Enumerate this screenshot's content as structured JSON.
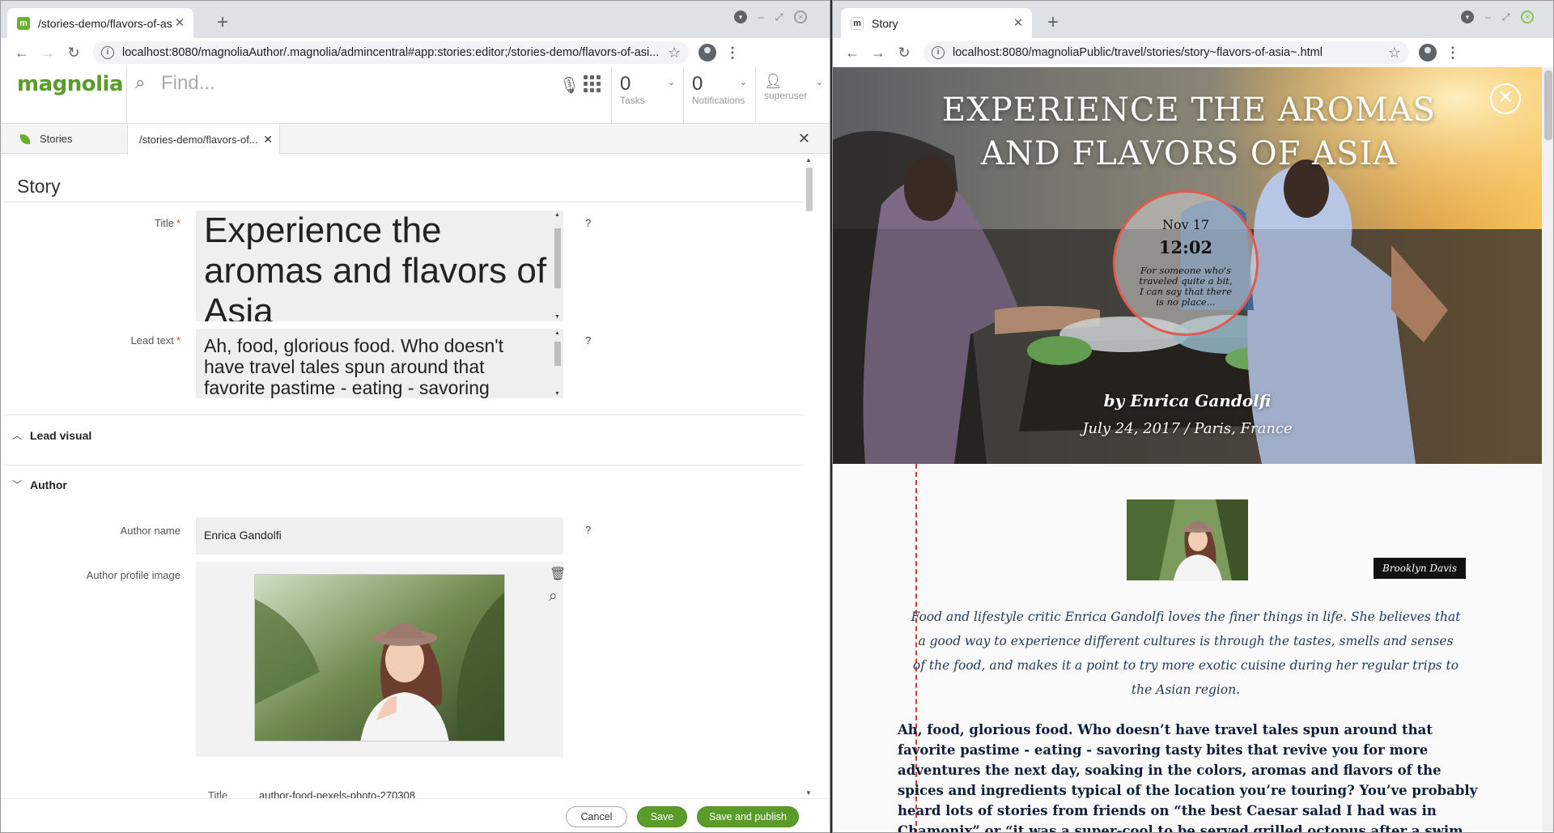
{
  "left_window": {
    "tab": {
      "title": "/stories-demo/flavors-of-asia",
      "favicon": "m"
    },
    "url": "localhost:8080/magnoliaAuthor/.magnolia/admincentral#app:stories:editor;/stories-demo/flavors-of-asi...",
    "header": {
      "logo": "magnolia",
      "search_placeholder": "Find...",
      "tasks": {
        "count": "0",
        "label": "Tasks"
      },
      "notifications": {
        "count": "0",
        "label": "Notifications"
      },
      "user": {
        "label": "superuser"
      }
    },
    "app_tabs": [
      {
        "label": "Stories"
      },
      {
        "label": "/stories-demo/flavors-of..."
      }
    ],
    "form": {
      "section": "Story",
      "title_label": "Title",
      "title_value": "Experience the aromas and flavors of Asia",
      "lead_label": "Lead text",
      "lead_value": "Ah, food, glorious food. Who doesn't have travel tales spun around that favorite pastime - eating - savoring",
      "help": "?",
      "lead_visual": "Lead visual",
      "author": "Author",
      "author_name_label": "Author name",
      "author_name_value": "Enrica Gandolfi",
      "author_image_label": "Author profile image",
      "image_title_label": "Title",
      "image_title_value": "author-food-pexels-photo-270308"
    },
    "actions": {
      "cancel": "Cancel",
      "save": "Save",
      "save_publish": "Save and publish"
    }
  },
  "right_window": {
    "tab": {
      "title": "Story",
      "favicon": "m"
    },
    "url": "localhost:8080/magnoliaPublic/travel/stories/story~flavors-of-asia~.html",
    "hero": {
      "title": "Experience the aromas and flavors of Asia",
      "date": "Nov 17",
      "time": "12:02",
      "quote": "For someone who's traveled quite a bit, I can say that there is no place...",
      "byline": "by Enrica Gandolfi",
      "dateline": "July 24, 2017 / Paris, France"
    },
    "photo_credit": "Brooklyn Davis",
    "bio": "Food and lifestyle critic Enrica Gandolfi loves the finer things in life. She believes that a good way to experience different cultures is through the tastes, smells and senses of the food, and makes it a point to try more exotic cuisine during her regular trips to the Asian region.",
    "body": "Ah, food, glorious food. Who doesn’t have travel tales spun around that favorite pastime - eating - savoring tasty bites that revive you for more adventures the next day, soaking in the colors, aromas and flavors of the spices and ingredients typical of the location you’re touring? You’ve probably heard lots of stories from friends on “the best Caesar salad I had was in Chamonix” or “it was a super-cool to be served grilled octopus after a swim in the harbor in the Cyclades”..."
  },
  "colors": {
    "brand_green": "#599c2a",
    "required": "#e04a3f",
    "accent_red": "#e05a52"
  }
}
